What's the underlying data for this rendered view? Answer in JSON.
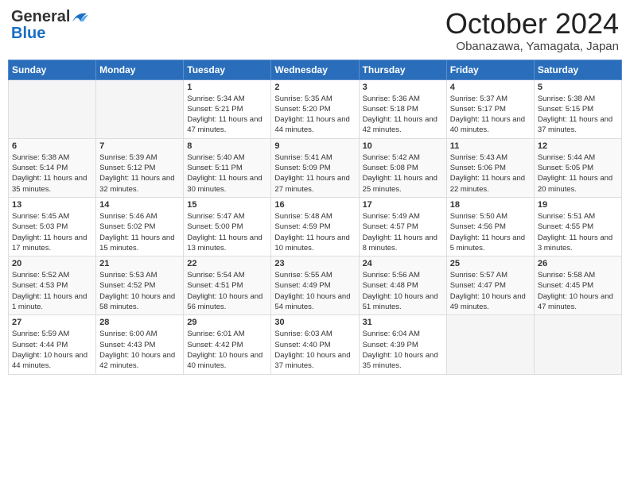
{
  "header": {
    "logo_general": "General",
    "logo_blue": "Blue",
    "month": "October 2024",
    "location": "Obanazawa, Yamagata, Japan"
  },
  "weekdays": [
    "Sunday",
    "Monday",
    "Tuesday",
    "Wednesday",
    "Thursday",
    "Friday",
    "Saturday"
  ],
  "weeks": [
    [
      {
        "day": "",
        "info": ""
      },
      {
        "day": "",
        "info": ""
      },
      {
        "day": "1",
        "info": "Sunrise: 5:34 AM\nSunset: 5:21 PM\nDaylight: 11 hours and 47 minutes."
      },
      {
        "day": "2",
        "info": "Sunrise: 5:35 AM\nSunset: 5:20 PM\nDaylight: 11 hours and 44 minutes."
      },
      {
        "day": "3",
        "info": "Sunrise: 5:36 AM\nSunset: 5:18 PM\nDaylight: 11 hours and 42 minutes."
      },
      {
        "day": "4",
        "info": "Sunrise: 5:37 AM\nSunset: 5:17 PM\nDaylight: 11 hours and 40 minutes."
      },
      {
        "day": "5",
        "info": "Sunrise: 5:38 AM\nSunset: 5:15 PM\nDaylight: 11 hours and 37 minutes."
      }
    ],
    [
      {
        "day": "6",
        "info": "Sunrise: 5:38 AM\nSunset: 5:14 PM\nDaylight: 11 hours and 35 minutes."
      },
      {
        "day": "7",
        "info": "Sunrise: 5:39 AM\nSunset: 5:12 PM\nDaylight: 11 hours and 32 minutes."
      },
      {
        "day": "8",
        "info": "Sunrise: 5:40 AM\nSunset: 5:11 PM\nDaylight: 11 hours and 30 minutes."
      },
      {
        "day": "9",
        "info": "Sunrise: 5:41 AM\nSunset: 5:09 PM\nDaylight: 11 hours and 27 minutes."
      },
      {
        "day": "10",
        "info": "Sunrise: 5:42 AM\nSunset: 5:08 PM\nDaylight: 11 hours and 25 minutes."
      },
      {
        "day": "11",
        "info": "Sunrise: 5:43 AM\nSunset: 5:06 PM\nDaylight: 11 hours and 22 minutes."
      },
      {
        "day": "12",
        "info": "Sunrise: 5:44 AM\nSunset: 5:05 PM\nDaylight: 11 hours and 20 minutes."
      }
    ],
    [
      {
        "day": "13",
        "info": "Sunrise: 5:45 AM\nSunset: 5:03 PM\nDaylight: 11 hours and 17 minutes."
      },
      {
        "day": "14",
        "info": "Sunrise: 5:46 AM\nSunset: 5:02 PM\nDaylight: 11 hours and 15 minutes."
      },
      {
        "day": "15",
        "info": "Sunrise: 5:47 AM\nSunset: 5:00 PM\nDaylight: 11 hours and 13 minutes."
      },
      {
        "day": "16",
        "info": "Sunrise: 5:48 AM\nSunset: 4:59 PM\nDaylight: 11 hours and 10 minutes."
      },
      {
        "day": "17",
        "info": "Sunrise: 5:49 AM\nSunset: 4:57 PM\nDaylight: 11 hours and 8 minutes."
      },
      {
        "day": "18",
        "info": "Sunrise: 5:50 AM\nSunset: 4:56 PM\nDaylight: 11 hours and 5 minutes."
      },
      {
        "day": "19",
        "info": "Sunrise: 5:51 AM\nSunset: 4:55 PM\nDaylight: 11 hours and 3 minutes."
      }
    ],
    [
      {
        "day": "20",
        "info": "Sunrise: 5:52 AM\nSunset: 4:53 PM\nDaylight: 11 hours and 1 minute."
      },
      {
        "day": "21",
        "info": "Sunrise: 5:53 AM\nSunset: 4:52 PM\nDaylight: 10 hours and 58 minutes."
      },
      {
        "day": "22",
        "info": "Sunrise: 5:54 AM\nSunset: 4:51 PM\nDaylight: 10 hours and 56 minutes."
      },
      {
        "day": "23",
        "info": "Sunrise: 5:55 AM\nSunset: 4:49 PM\nDaylight: 10 hours and 54 minutes."
      },
      {
        "day": "24",
        "info": "Sunrise: 5:56 AM\nSunset: 4:48 PM\nDaylight: 10 hours and 51 minutes."
      },
      {
        "day": "25",
        "info": "Sunrise: 5:57 AM\nSunset: 4:47 PM\nDaylight: 10 hours and 49 minutes."
      },
      {
        "day": "26",
        "info": "Sunrise: 5:58 AM\nSunset: 4:45 PM\nDaylight: 10 hours and 47 minutes."
      }
    ],
    [
      {
        "day": "27",
        "info": "Sunrise: 5:59 AM\nSunset: 4:44 PM\nDaylight: 10 hours and 44 minutes."
      },
      {
        "day": "28",
        "info": "Sunrise: 6:00 AM\nSunset: 4:43 PM\nDaylight: 10 hours and 42 minutes."
      },
      {
        "day": "29",
        "info": "Sunrise: 6:01 AM\nSunset: 4:42 PM\nDaylight: 10 hours and 40 minutes."
      },
      {
        "day": "30",
        "info": "Sunrise: 6:03 AM\nSunset: 4:40 PM\nDaylight: 10 hours and 37 minutes."
      },
      {
        "day": "31",
        "info": "Sunrise: 6:04 AM\nSunset: 4:39 PM\nDaylight: 10 hours and 35 minutes."
      },
      {
        "day": "",
        "info": ""
      },
      {
        "day": "",
        "info": ""
      }
    ]
  ]
}
